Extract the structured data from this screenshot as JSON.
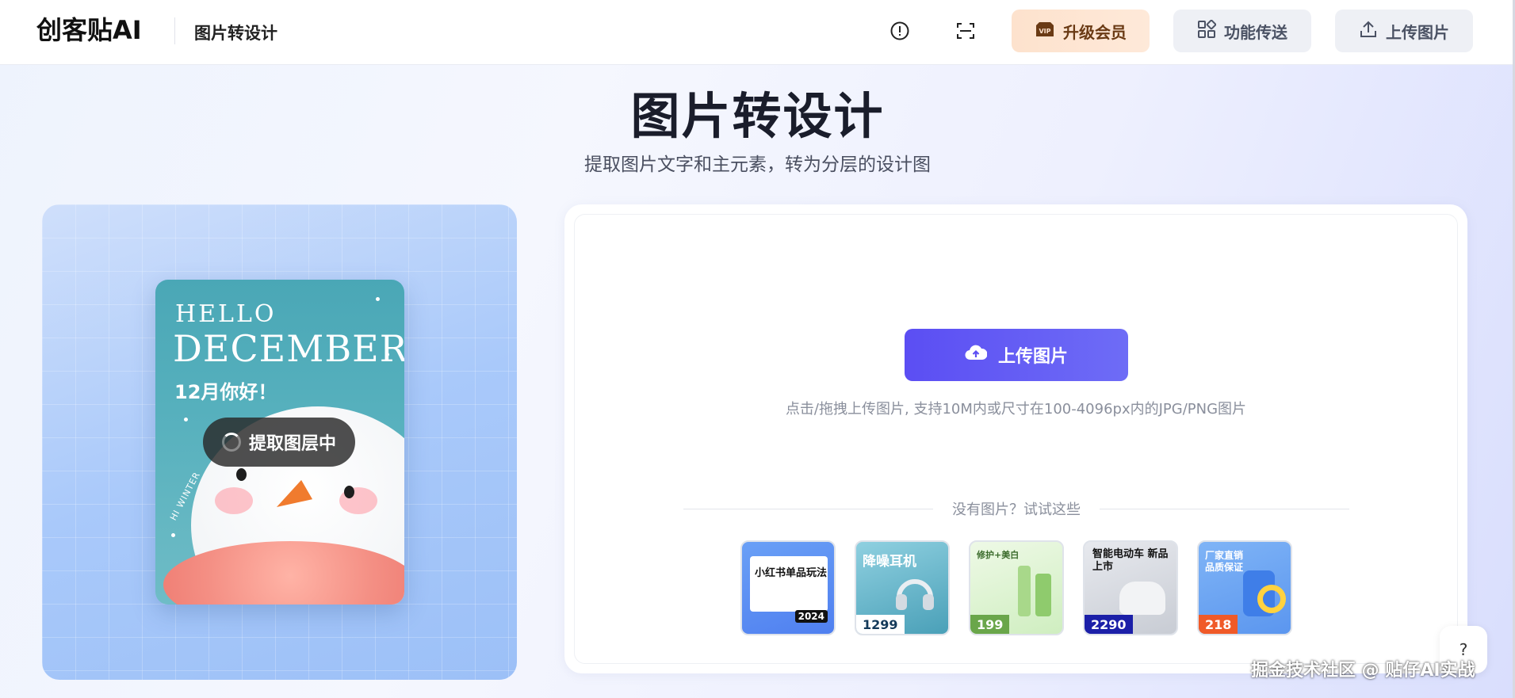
{
  "header": {
    "logo": "创客贴AI",
    "page_name": "图片转设计",
    "vip_label": "升级会员",
    "features_label": "功能传送",
    "upload_label": "上传图片"
  },
  "hero": {
    "title": "图片转设计",
    "subtitle": "提取图片文字和主元素，转为分层的设计图"
  },
  "preview": {
    "card_hello": "HELLO",
    "card_december": "DECEMBER",
    "card_greeting": "12月你好！",
    "card_side_text": "HI WINTER",
    "status": "提取图层中"
  },
  "upload": {
    "button_label": "上传图片",
    "hint": "点击/拖拽上传图片, 支持10M内或尺寸在100-4096px内的JPG/PNG图片",
    "try_label": "没有图片？试试这些"
  },
  "samples": [
    {
      "title": "小红书单品玩法",
      "price": "",
      "tag": "2024"
    },
    {
      "title": "降噪耳机",
      "price": "1299"
    },
    {
      "title": "修护+美白",
      "price": "199"
    },
    {
      "title": "智能电动车 新品上市",
      "price": "2290"
    },
    {
      "title": "厂家直销 品质保证",
      "price": "218"
    }
  ],
  "help_label": "?",
  "watermark": "掘金技术社区 @ 贴仔AI实战",
  "colors": {
    "primary": "#5b4ef3",
    "vip_bg": "#fde2cd",
    "secondary_btn_bg": "#eef0f5"
  },
  "icons": [
    "info-icon",
    "scan-icon",
    "vip-icon",
    "grid-icon",
    "upload-icon",
    "cloud-upload-icon",
    "spinner-icon"
  ]
}
